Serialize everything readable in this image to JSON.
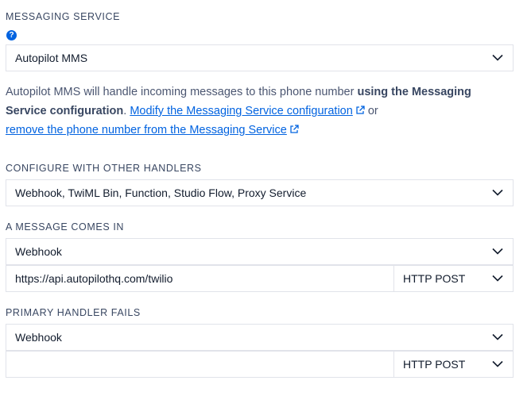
{
  "messaging_service": {
    "label": "MESSAGING SERVICE",
    "selected": "Autopilot MMS",
    "help_icon": "question-circle-icon"
  },
  "description": {
    "intro": "Autopilot MMS will handle incoming messages to this phone number ",
    "bold": "using the Messaging Service configuration",
    "period": ". ",
    "link1": "Modify the Messaging Service configuration",
    "or": " or",
    "link2": "remove the phone number from the Messaging Service"
  },
  "other_handlers": {
    "label": "CONFIGURE WITH OTHER HANDLERS",
    "selected": "Webhook, TwiML Bin, Function, Studio Flow, Proxy Service"
  },
  "message_comes_in": {
    "label": "A MESSAGE COMES IN",
    "selected": "Webhook",
    "url": "https://api.autopilothq.com/twilio",
    "method": "HTTP POST"
  },
  "primary_handler_fails": {
    "label": "PRIMARY HANDLER FAILS",
    "selected": "Webhook",
    "url": "",
    "method": "HTTP POST"
  },
  "colors": {
    "link": "#0263e0",
    "border": "#e1e3ea",
    "label": "#394762"
  }
}
